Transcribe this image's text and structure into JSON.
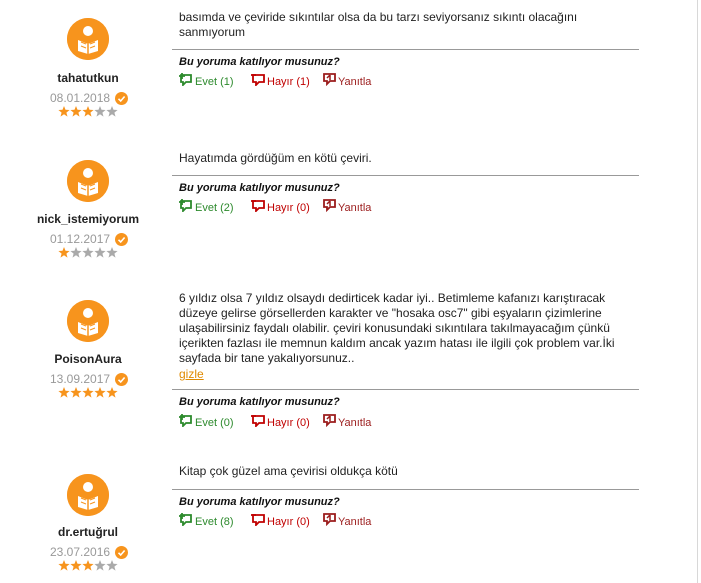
{
  "question_label": "Bu yoruma katılıyor musunuz?",
  "colors": {
    "accent": "#f7941d",
    "yes": "#2d8a2d",
    "no": "#c00000",
    "reply": "#9b1c1c",
    "star_on": "#f7941d",
    "star_off": "#aaaaaa",
    "hide_link": "#e08a00"
  },
  "reviews": [
    {
      "username": "tahatutkun",
      "date": "08.01.2018",
      "rating": 3,
      "text": "basımda ve çeviride sıkıntılar olsa da bu tarzı seviyorsanız sıkıntı olacağını sanmıyorum",
      "yes_label": "Evet (1)",
      "no_label": "Hayır (1)",
      "reply_label": "Yanıtla"
    },
    {
      "username": "nick_istemiyorum",
      "date": "01.12.2017",
      "rating": 1,
      "text": "Hayatımda gördüğüm en kötü çeviri.",
      "yes_label": "Evet (2)",
      "no_label": "Hayır (0)",
      "reply_label": "Yanıtla"
    },
    {
      "username": "PoisonAura",
      "date": "13.09.2017",
      "rating": 5,
      "text": "6 yıldız olsa 7 yıldız olsaydı dedirticek kadar iyi.. Betimleme kafanızı karıştıracak düzeye gelirse görsellerden karakter ve \"hosaka osc7\" gibi eşyaların çizimlerine ulaşabilirsiniz faydalı olabilir. çeviri konusundaki sıkıntılara takılmayacağım çünkü içerikten fazlası ile memnun kaldım ancak yazım hatası ile ilgili çok problem var.İki sayfada bir tane yakalıyorsunuz..",
      "hide_label": "gizle",
      "yes_label": "Evet (0)",
      "no_label": "Hayır (0)",
      "reply_label": "Yanıtla"
    },
    {
      "username": "dr.ertuğrul",
      "date": "23.07.2016",
      "rating": 3,
      "text": "Kitap çok güzel ama çevirisi oldukça kötü",
      "yes_label": "Evet (8)",
      "no_label": "Hayır (0)",
      "reply_label": "Yanıtla"
    }
  ]
}
